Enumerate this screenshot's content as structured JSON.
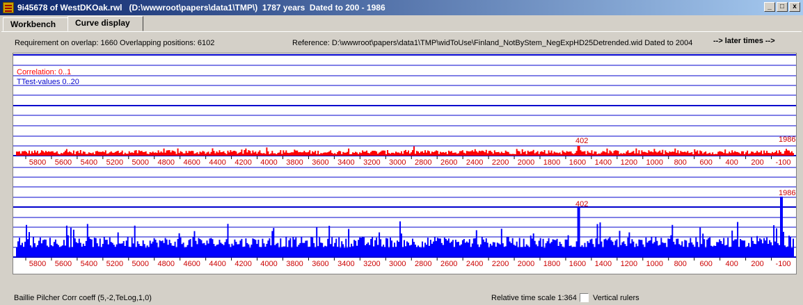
{
  "window": {
    "title": "9i45678 of WestDKOak.rwl   (D:\\wwwroot\\papers\\data1\\TMP\\)  1787 years  Dated to 200 - 1986",
    "controls": [
      "_",
      "□",
      "x"
    ]
  },
  "tabs": [
    {
      "label": "Workbench",
      "active": false
    },
    {
      "label": "Curve display",
      "active": true
    }
  ],
  "info": {
    "overlap": "Requirement on overlap: 1660  Overlapping positions: 6102",
    "reference": "Reference: D:\\wwwroot\\papers\\data1\\TMP\\widToUse\\Finland_NotByStem_NegExpHD25Detrended.wid  Dated to 2004",
    "later_times": "--> later times -->"
  },
  "legend": {
    "correlation": "Correlation: 0..1",
    "ttest": "TTest-values 0..20"
  },
  "colors": {
    "correlation": "#ff0000",
    "ttest": "#0000ff",
    "tick_label": "#cc0000"
  },
  "chart_data": {
    "type": "bar",
    "x_ticks": [
      5800,
      5600,
      5400,
      5200,
      5000,
      4800,
      4600,
      4400,
      4200,
      4000,
      3800,
      3600,
      3400,
      3200,
      3000,
      2800,
      2600,
      2400,
      2200,
      2000,
      1800,
      1600,
      1400,
      1200,
      1000,
      800,
      600,
      400,
      200,
      -100
    ],
    "series": [
      {
        "name": "Correlation: 0..1",
        "range": [
          0,
          1
        ],
        "peak_labels": [
          "402",
          "1986"
        ]
      },
      {
        "name": "TTest-values 0..20",
        "range": [
          0,
          20
        ],
        "peak_labels": [
          "402",
          "1986"
        ]
      }
    ]
  },
  "footer": {
    "method": "Baillie Pilcher Corr coeff (5,-2,TeLog,1,0)",
    "time_scale": "Relative time scale 1:364",
    "vertical_rulers": "Vertical rulers",
    "vertical_rulers_checked": false
  }
}
